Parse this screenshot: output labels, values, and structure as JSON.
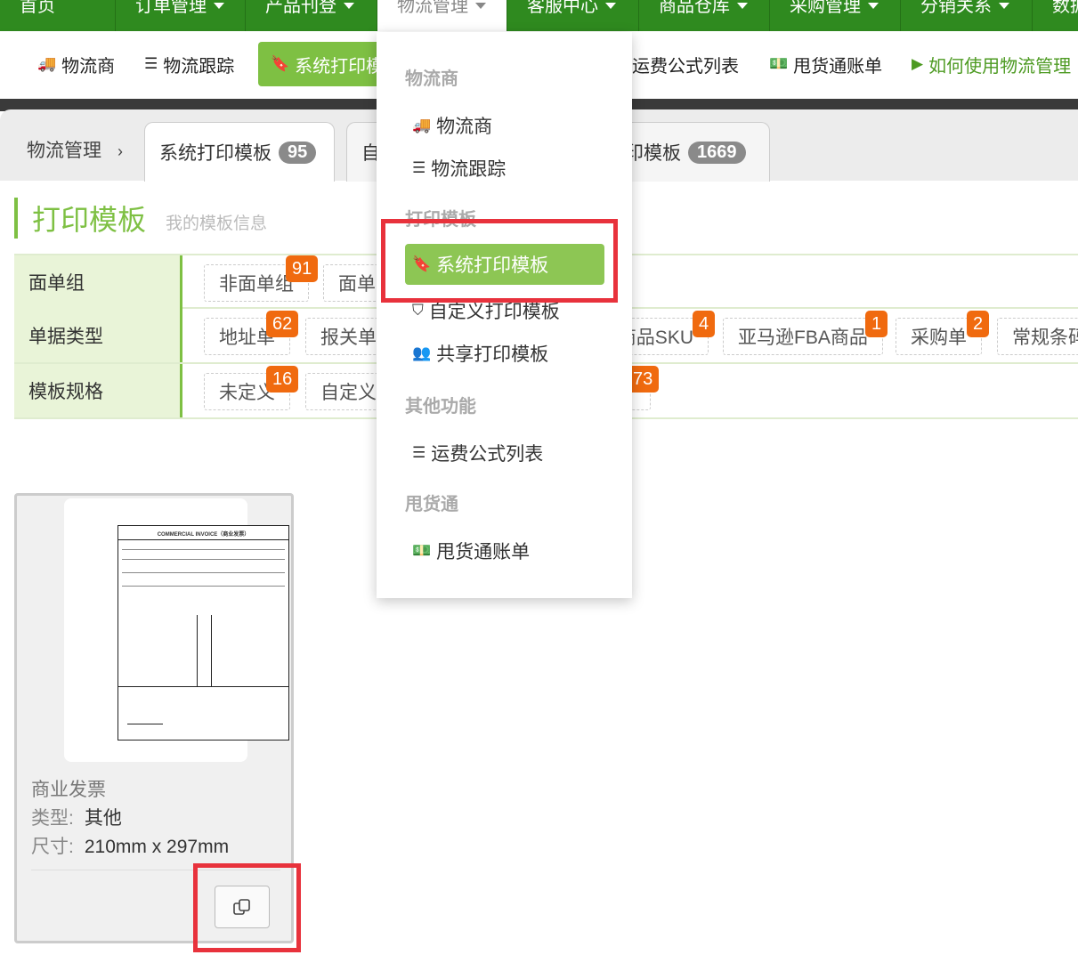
{
  "topnav": {
    "items": [
      "首页",
      "订单管理",
      "产品刊登",
      "物流管理",
      "客服中心",
      "商品仓库",
      "采购管理",
      "分销关系",
      "数据"
    ]
  },
  "subnav": {
    "logistics": "物流商",
    "tracking": "物流跟踪",
    "system_print": "系统打印模板",
    "freight_formula": "运费公式列表",
    "ygt_bill": "甩货通账单",
    "how_to": "如何使用物流管理"
  },
  "tabs": {
    "crumb": "物流管理",
    "crumb_chev": "›",
    "system_label": "系统打印模板",
    "system_count": "95",
    "custom_label": "自",
    "shared_label": "印模板",
    "shared_count": "1669"
  },
  "title": {
    "main": "打印模板",
    "sub": "我的模板信息"
  },
  "filters": {
    "group_label": "面单组",
    "group_chips": [
      "非面单组",
      "面单"
    ],
    "group_badge": "91",
    "doc_label": "单据类型",
    "doc_chips": [
      "地址单",
      "报关单",
      "商品SKU",
      "亚马逊FBA商品",
      "采购单",
      "常规条码"
    ],
    "doc_badges": [
      "62",
      "4",
      "1",
      "2"
    ],
    "spec_label": "模板规格",
    "spec_chips": [
      "未定义",
      "自定义"
    ],
    "spec_badges": [
      "16",
      "73"
    ]
  },
  "dropdown": {
    "head_logistics": "物流商",
    "item_logistics": "物流商",
    "item_tracking": "物流跟踪",
    "head_print": "打印模板",
    "item_system": "系统打印模板",
    "item_custom": "自定义打印模板",
    "item_shared": "共享打印模板",
    "head_other": "其他功能",
    "item_formula": "运费公式列表",
    "head_ygt": "甩货通",
    "item_ygt_bill": "甩货通账单"
  },
  "card": {
    "name": "商业发票",
    "type_key": "类型:",
    "type_val": "其他",
    "size_key": "尺寸:",
    "size_val": "210mm x 297mm",
    "doc_title": "COMMERCIAL INVOICE（商业发票）"
  },
  "colors": {
    "nav_green": "#2f8a1f",
    "accent": "#7ec043",
    "badge": "#f06a0f",
    "highlight": "#e8323c"
  }
}
